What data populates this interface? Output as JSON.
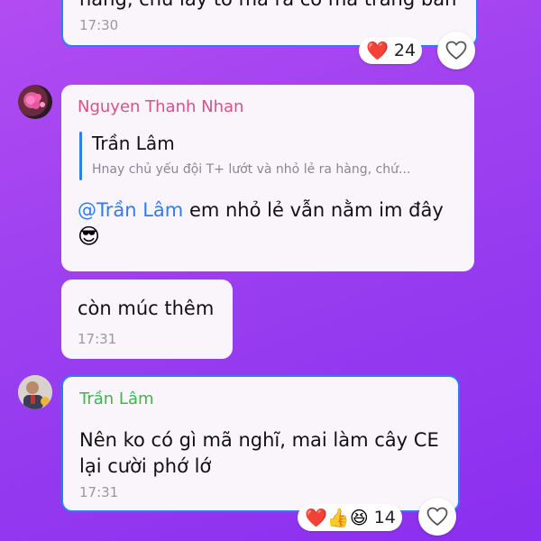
{
  "messages": [
    {
      "text_partial": "hàng, chủ lảy tó mà ra có mà trắng bảnh",
      "time": "17:30",
      "reactions": {
        "emoji": "❤️",
        "count": "24"
      }
    },
    {
      "sender": "Nguyen Thanh Nhan",
      "sender_color": "#d6528a",
      "quote": {
        "author": "Trần Lâm",
        "text": "Hnay chủ yếu đội T+ lướt và nhỏ lẻ ra hàng, chứ..."
      },
      "mention": "@Trần Lâm",
      "text": " em nhỏ lẻ vẫn nằm im đây",
      "emoji": "😎"
    },
    {
      "text": "còn múc thêm",
      "time": "17:31"
    },
    {
      "sender": "Trần Lâm",
      "sender_color": "#3fb64a",
      "text_line1": "Nên ko có gì mã nghĩ, mai làm cây CE",
      "text_line2": "lại cười phớ lớ",
      "time": "17:31",
      "reactions": {
        "emojis": [
          "❤️",
          "👍",
          "😆"
        ],
        "count": "14"
      }
    }
  ],
  "icons": {
    "heart_outline": "heart-outline-icon"
  }
}
